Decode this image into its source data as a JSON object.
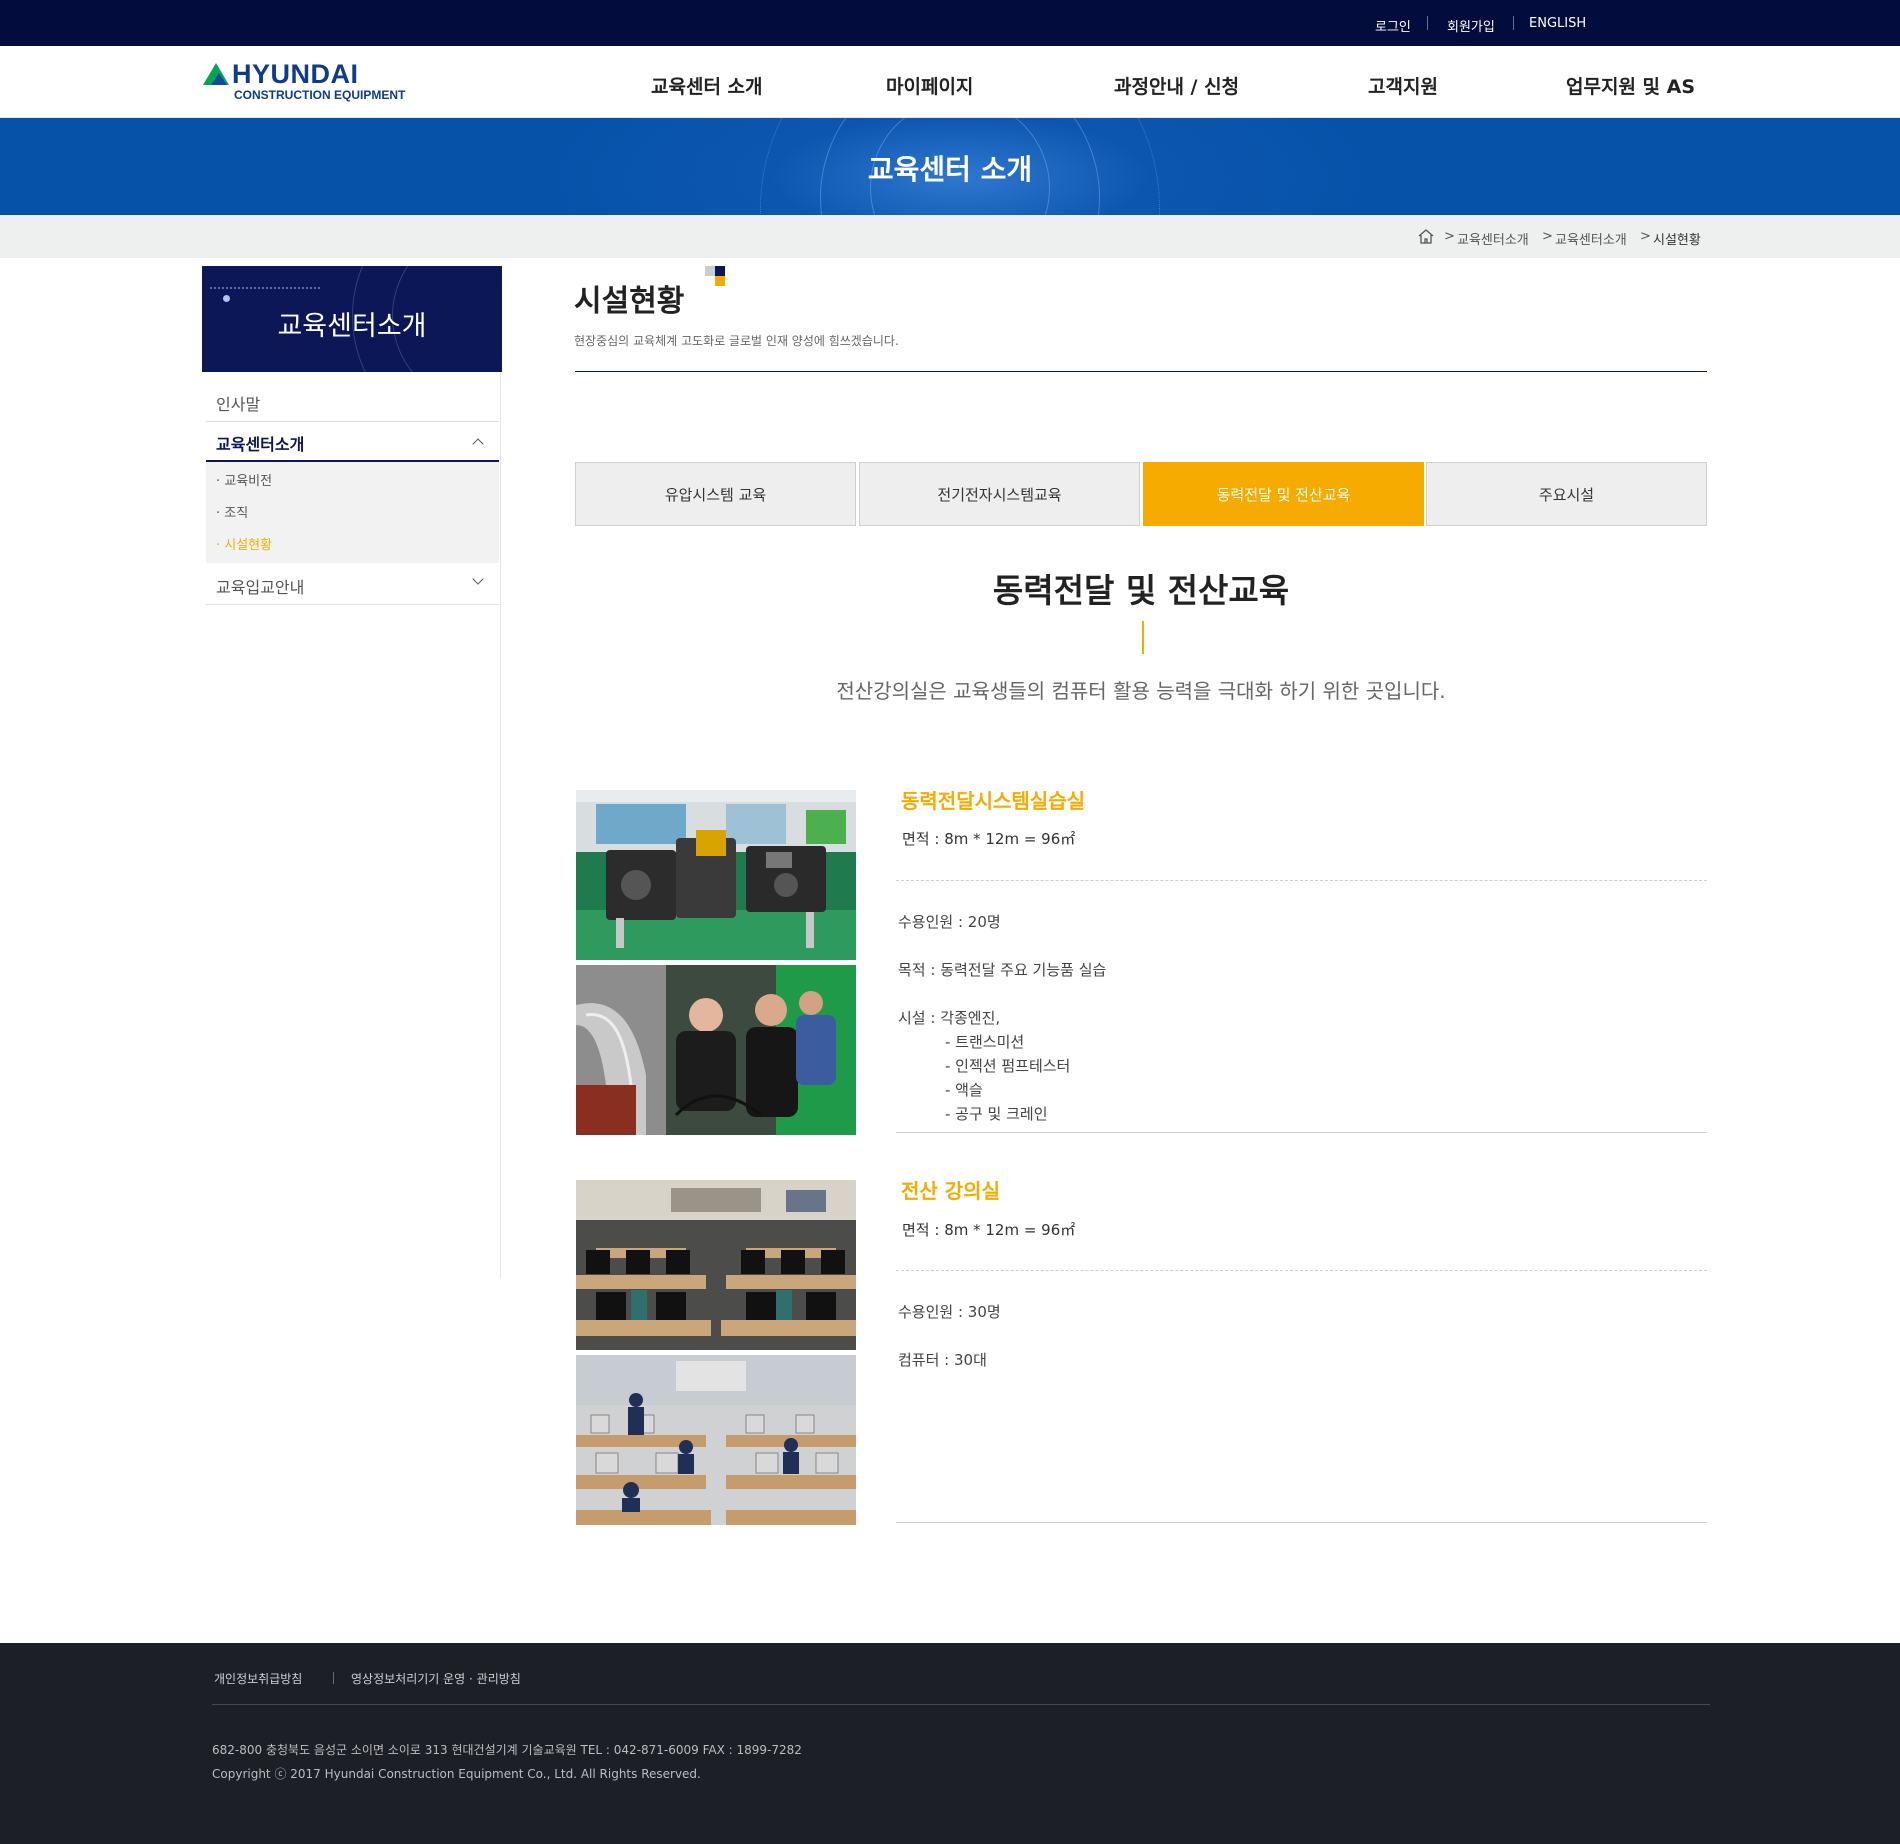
{
  "util_nav": {
    "login": "로그인",
    "join": "회원가입",
    "english": "ENGLISH"
  },
  "logo": {
    "brand": "HYUNDAI",
    "sub": "CONSTRUCTION EQUIPMENT"
  },
  "gnb": [
    "교육센터 소개",
    "마이페이지",
    "과정안내 / 신청",
    "고객지원",
    "업무지원 및 AS"
  ],
  "banner": {
    "title": "교육센터 소개"
  },
  "breadcrumb": {
    "separator": ">",
    "items": [
      "교육센터소개",
      "교육센터소개",
      "시설현황"
    ]
  },
  "sidebar": {
    "title": "교육센터소개",
    "menu": [
      {
        "label": "인사말"
      },
      {
        "label": "교육센터소개",
        "expanded": true,
        "children": [
          "· 교육비전",
          "· 조직",
          "· 시설현황"
        ],
        "active_child": 2
      },
      {
        "label": "교육입교안내",
        "expanded": false
      }
    ]
  },
  "page": {
    "title": "시설현황",
    "description": "현장중심의 교육체계 고도화로 글로벌 인재 양성에 힘쓰겠습니다."
  },
  "tabs": [
    "유압시스템 교육",
    "전기전자시스템교육",
    "동력전달 및 전산교육",
    "주요시설"
  ],
  "active_tab": 2,
  "section": {
    "title": "동력전달 및 전산교육",
    "description": "전산강의실은 교육생들의 컴퓨터 활용 능력을 극대화 하기 위한 곳입니다."
  },
  "facilities": [
    {
      "name": "동력전달시스템실습실",
      "area": "면적 : 8m * 12m = 96㎡",
      "capacity": "수용인원 : 20명",
      "purpose": "목적 : 동력전달 주요 기능품 실습",
      "equipment_label": "시설 : 각종엔진,",
      "equipment_items": [
        "- 트랜스미션",
        "- 인젝션 펌프테스터",
        "- 액슬",
        "- 공구 및 크레인"
      ]
    },
    {
      "name": "전산 강의실",
      "area": "면적 : 8m * 12m = 96㎡",
      "capacity": "수용인원 : 30명",
      "computers": "컴퓨터 : 30대"
    }
  ],
  "footer": {
    "links": [
      "개인정보취급방침",
      "영상정보처리기기 운영 · 관리방침"
    ],
    "address": "682-800  충청북도 음성군 소이면 소이로 313 현대건설기계 기술교육원 TEL : 042-871-6009 FAX : 1899-7282",
    "copyright": "Copyright ⓒ 2017 Hyundai Construction Equipment Co., Ltd. All Rights Reserved."
  },
  "colors": {
    "navy": "#020c3d",
    "accent": "#f6ab00",
    "banner_blue": "#0652a9",
    "footer": "#1d1f27"
  },
  "icons": [
    "home-icon",
    "chevron-up-icon",
    "chevron-down-icon"
  ]
}
